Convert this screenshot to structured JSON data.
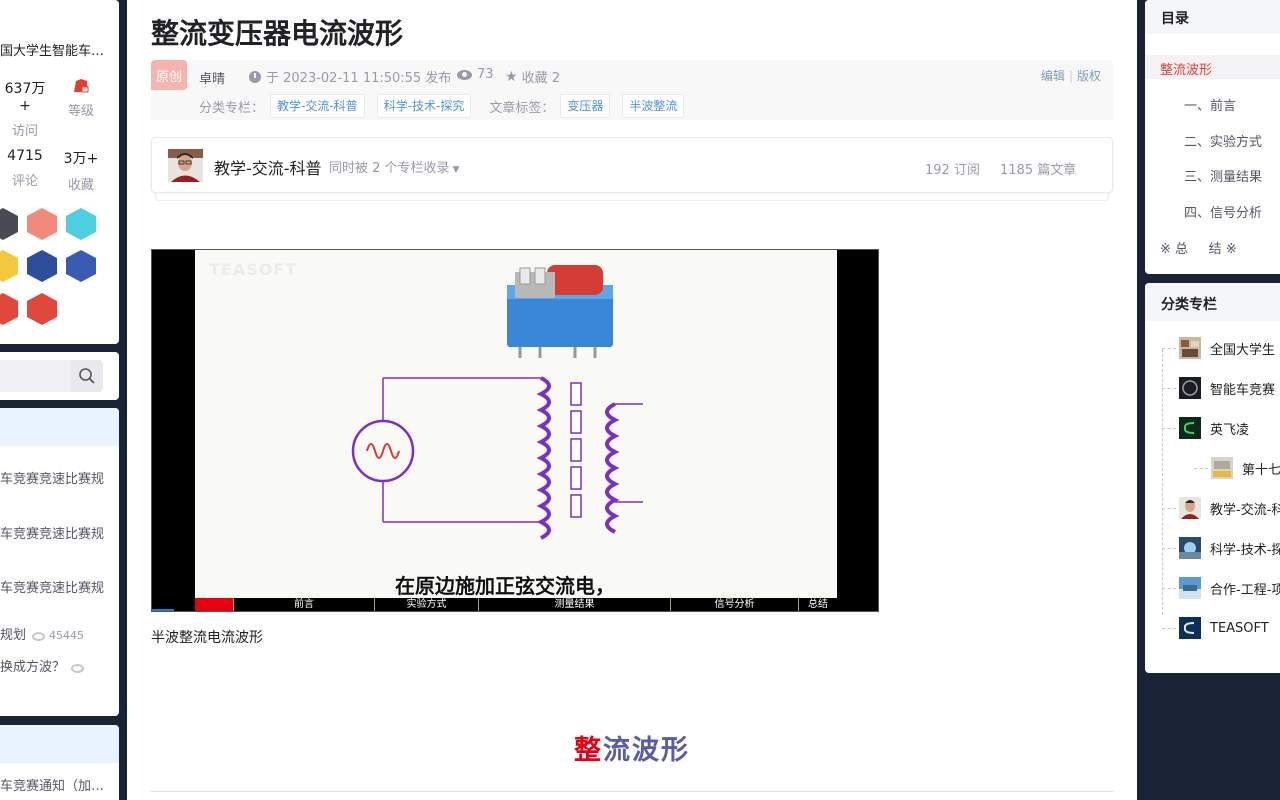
{
  "left_sidebar": {
    "profile": {
      "name_truncated": "国大学生智能车…",
      "stats_row1": [
        {
          "value": "637万+",
          "label": "访问"
        },
        {
          "value": "",
          "label": "等级"
        }
      ],
      "stats_row2": [
        {
          "value": "4715",
          "label": "评论"
        },
        {
          "value": "3万+",
          "label": "收藏"
        }
      ]
    },
    "hot_articles": [
      {
        "title": "车竞赛竞速比赛规"
      },
      {
        "title": "车竞赛竞速比赛规"
      },
      {
        "title": "车竞赛竞速比赛规"
      },
      {
        "title": "规划",
        "views": "45445"
      },
      {
        "title": "换成方波？"
      }
    ],
    "bottom_article": "车竞赛通知（加…"
  },
  "article": {
    "title": "整流变压器电流波形",
    "original_badge": "原创",
    "author": "卓晴",
    "date_text": "于 2023-02-11 11:50:55 发布",
    "views": "73",
    "favorites_text": "收藏 2",
    "edit_label": "编辑",
    "copyright_label": "版权",
    "column_label": "分类专栏：",
    "columns": [
      "教学-交流-科普",
      "科学-技术-探究"
    ],
    "tags_label": "文章标签：",
    "tags": [
      "变压器",
      "半波整流"
    ],
    "column_card": {
      "name": "教学-交流-科普",
      "also_included": "同时被 2 个专栏收录",
      "subscriptions": "192 订阅",
      "articles": "1185 篇文章"
    },
    "video": {
      "subtitle": "在原边施加正弦交流电，",
      "chapters": [
        "前言",
        "实验方式",
        "测量结果",
        "信号分析",
        "总结"
      ]
    },
    "figure_caption": "半波整流电流波形",
    "section_heading": [
      "整",
      "流",
      "波",
      "形"
    ]
  },
  "toc": {
    "title": "目录",
    "items": [
      "整流波形",
      "一、前言",
      "二、实验方式",
      "三、测量结果",
      "四、信号分析",
      "※ 总     结 ※"
    ]
  },
  "category_columns": {
    "title": "分类专栏",
    "items": [
      "全国大学生",
      "智能车竞赛",
      "英飞凌",
      "第十七",
      "教学-交流-科",
      "科学-技术-探",
      "合作-工程-项",
      "TEASOFT"
    ]
  },
  "colors": {
    "heading_red": "#e60012",
    "heading_blue": "#5b5ba6",
    "toc_active": "#e33e33",
    "tag_text": "#5094d5",
    "coil_purple": "#7b2fc7"
  }
}
